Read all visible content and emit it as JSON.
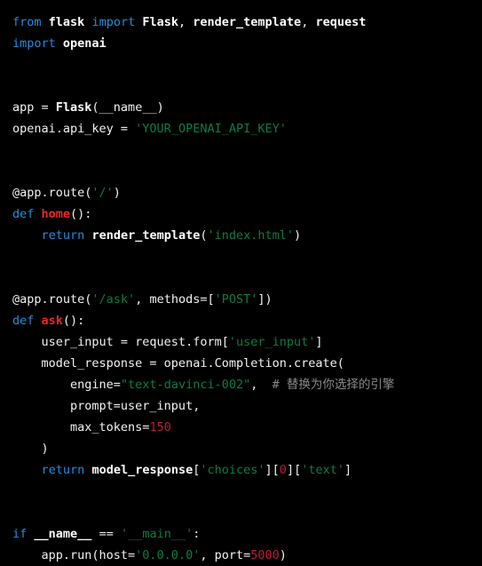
{
  "editor": {
    "language": "python",
    "theme": "dark",
    "background_color": "#000000",
    "foreground_color": "#f2f2f2",
    "colors": {
      "keyword": "#1f8fde",
      "builtin": "#ffffff",
      "function": "#e8282a",
      "string": "#0a7d43",
      "number": "#c4173c",
      "comment": "#8a8a8a",
      "plain": "#f2f2f2"
    }
  },
  "code": {
    "lines": [
      {
        "index": 1,
        "text": "from flask import Flask, render_template, request",
        "tokens": [
          {
            "t": "from",
            "c": "kw"
          },
          {
            "t": " ",
            "c": "pl"
          },
          {
            "t": "flask",
            "c": "plb"
          },
          {
            "t": " ",
            "c": "pl"
          },
          {
            "t": "import",
            "c": "kw"
          },
          {
            "t": " ",
            "c": "pl"
          },
          {
            "t": "Flask",
            "c": "bi"
          },
          {
            "t": ", ",
            "c": "pl"
          },
          {
            "t": "render_template",
            "c": "bi"
          },
          {
            "t": ", ",
            "c": "pl"
          },
          {
            "t": "request",
            "c": "bi"
          }
        ]
      },
      {
        "index": 2,
        "text": "import openai",
        "tokens": [
          {
            "t": "import",
            "c": "kw"
          },
          {
            "t": " ",
            "c": "pl"
          },
          {
            "t": "openai",
            "c": "plb"
          }
        ]
      },
      {
        "index": 3,
        "text": "",
        "tokens": []
      },
      {
        "index": 4,
        "text": "",
        "tokens": []
      },
      {
        "index": 5,
        "text": "app = Flask(__name__)",
        "tokens": [
          {
            "t": "app = ",
            "c": "pl"
          },
          {
            "t": "Flask",
            "c": "bi"
          },
          {
            "t": "(__name__)",
            "c": "pl"
          }
        ]
      },
      {
        "index": 6,
        "text": "openai.api_key = 'YOUR_OPENAI_API_KEY'",
        "tokens": [
          {
            "t": "openai.api_key = ",
            "c": "pl"
          },
          {
            "t": "'YOUR_OPENAI_API_KEY'",
            "c": "str"
          }
        ]
      },
      {
        "index": 7,
        "text": "",
        "tokens": []
      },
      {
        "index": 8,
        "text": "",
        "tokens": []
      },
      {
        "index": 9,
        "text": "@app.route('/')",
        "tokens": [
          {
            "t": "@app.route(",
            "c": "pl"
          },
          {
            "t": "'/'",
            "c": "str"
          },
          {
            "t": ")",
            "c": "pl"
          }
        ]
      },
      {
        "index": 10,
        "text": "def home():",
        "tokens": [
          {
            "t": "def",
            "c": "kw"
          },
          {
            "t": " ",
            "c": "pl"
          },
          {
            "t": "home",
            "c": "fn"
          },
          {
            "t": "():",
            "c": "pl"
          }
        ]
      },
      {
        "index": 11,
        "text": "    return render_template('index.html')",
        "tokens": [
          {
            "t": "    ",
            "c": "pl"
          },
          {
            "t": "return",
            "c": "kw"
          },
          {
            "t": " ",
            "c": "pl"
          },
          {
            "t": "render_template",
            "c": "bi"
          },
          {
            "t": "(",
            "c": "pl"
          },
          {
            "t": "'index.html'",
            "c": "str"
          },
          {
            "t": ")",
            "c": "pl"
          }
        ]
      },
      {
        "index": 12,
        "text": "",
        "tokens": []
      },
      {
        "index": 13,
        "text": "",
        "tokens": []
      },
      {
        "index": 14,
        "text": "@app.route('/ask', methods=['POST'])",
        "tokens": [
          {
            "t": "@app.route(",
            "c": "pl"
          },
          {
            "t": "'/ask'",
            "c": "str"
          },
          {
            "t": ", methods=[",
            "c": "pl"
          },
          {
            "t": "'POST'",
            "c": "str"
          },
          {
            "t": "])",
            "c": "pl"
          }
        ]
      },
      {
        "index": 15,
        "text": "def ask():",
        "tokens": [
          {
            "t": "def",
            "c": "kw"
          },
          {
            "t": " ",
            "c": "pl"
          },
          {
            "t": "ask",
            "c": "fn"
          },
          {
            "t": "():",
            "c": "pl"
          }
        ]
      },
      {
        "index": 16,
        "text": "    user_input = request.form['user_input']",
        "tokens": [
          {
            "t": "    user_input = request.form[",
            "c": "pl"
          },
          {
            "t": "'user_input'",
            "c": "str"
          },
          {
            "t": "]",
            "c": "pl"
          }
        ]
      },
      {
        "index": 17,
        "text": "    model_response = openai.Completion.create(",
        "tokens": [
          {
            "t": "    model_response = openai.Completion.create(",
            "c": "pl"
          }
        ]
      },
      {
        "index": 18,
        "text": "        engine=\"text-davinci-002\",  # 替换为你选择的引擎",
        "tokens": [
          {
            "t": "        engine=",
            "c": "pl"
          },
          {
            "t": "\"text-davinci-002\"",
            "c": "str"
          },
          {
            "t": ",  ",
            "c": "pl"
          },
          {
            "t": "# ",
            "c": "com"
          },
          {
            "t": "替换为你选择的引擎",
            "c": "cjk"
          }
        ]
      },
      {
        "index": 19,
        "text": "        prompt=user_input,",
        "tokens": [
          {
            "t": "        prompt=user_input,",
            "c": "pl"
          }
        ]
      },
      {
        "index": 20,
        "text": "        max_tokens=150",
        "tokens": [
          {
            "t": "        max_tokens=",
            "c": "pl"
          },
          {
            "t": "150",
            "c": "num"
          }
        ]
      },
      {
        "index": 21,
        "text": "    )",
        "tokens": [
          {
            "t": "    )",
            "c": "pl"
          }
        ]
      },
      {
        "index": 22,
        "text": "    return model_response['choices'][0]['text']",
        "tokens": [
          {
            "t": "    ",
            "c": "pl"
          },
          {
            "t": "return",
            "c": "kw"
          },
          {
            "t": " ",
            "c": "pl"
          },
          {
            "t": "model_response",
            "c": "plb"
          },
          {
            "t": "[",
            "c": "pl"
          },
          {
            "t": "'choices'",
            "c": "str"
          },
          {
            "t": "][",
            "c": "pl"
          },
          {
            "t": "0",
            "c": "num"
          },
          {
            "t": "][",
            "c": "pl"
          },
          {
            "t": "'text'",
            "c": "str"
          },
          {
            "t": "]",
            "c": "pl"
          }
        ]
      },
      {
        "index": 23,
        "text": "",
        "tokens": []
      },
      {
        "index": 24,
        "text": "",
        "tokens": []
      },
      {
        "index": 25,
        "text": "if __name__ == '__main__':",
        "tokens": [
          {
            "t": "if",
            "c": "kw"
          },
          {
            "t": " ",
            "c": "pl"
          },
          {
            "t": "__name__",
            "c": "plb"
          },
          {
            "t": " == ",
            "c": "pl"
          },
          {
            "t": "'__main__'",
            "c": "str"
          },
          {
            "t": ":",
            "c": "pl"
          }
        ]
      },
      {
        "index": 26,
        "text": "    app.run(host='0.0.0.0', port=5000)",
        "tokens": [
          {
            "t": "    app.run(host=",
            "c": "pl"
          },
          {
            "t": "'0.0.0.0'",
            "c": "str"
          },
          {
            "t": ", port=",
            "c": "pl"
          },
          {
            "t": "5000",
            "c": "num"
          },
          {
            "t": ")",
            "c": "pl"
          }
        ]
      }
    ]
  }
}
